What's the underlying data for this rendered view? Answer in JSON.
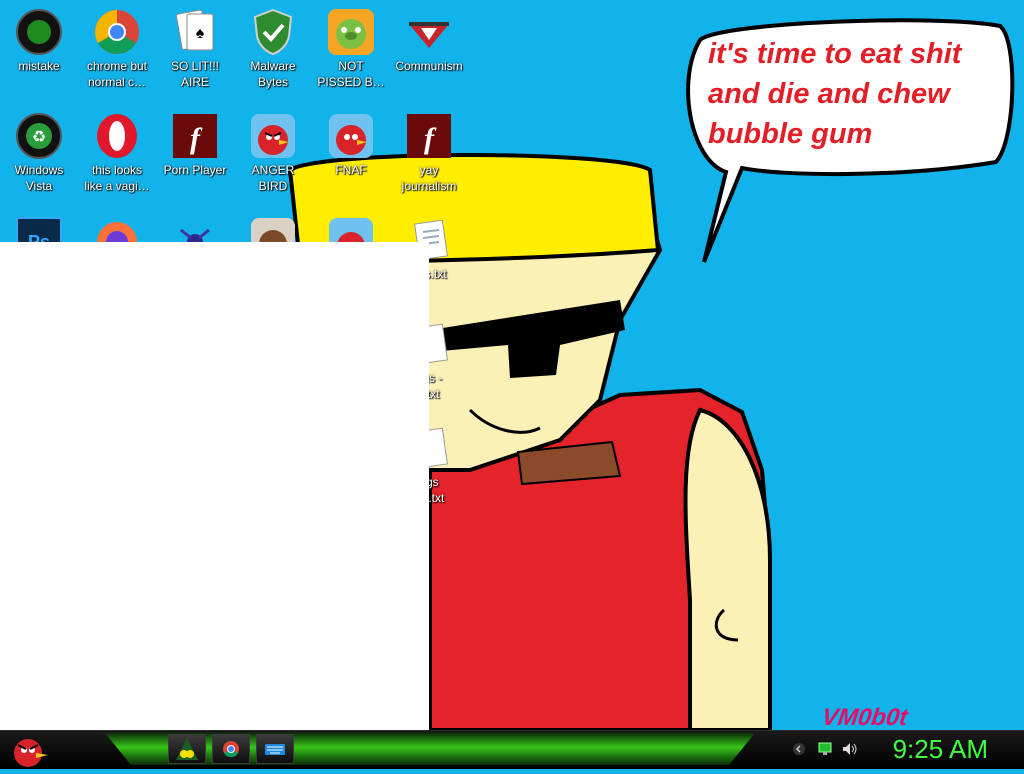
{
  "desktop_icons": {
    "mistake": "mistake",
    "chrome": [
      "chrome but",
      "normal c…"
    ],
    "solitaire": [
      "SO LIT!!!",
      "AIRE"
    ],
    "malwarebytes": [
      "Malware",
      "Bytes"
    ],
    "not_pissed": [
      "NOT",
      "PISSED B…"
    ],
    "communism": "Communism",
    "windows_vista": [
      "Windows",
      "Vista"
    ],
    "opera": [
      "this looks",
      "like a vagi…"
    ],
    "porn_player": "Porn Player",
    "anger_bird": [
      "ANGER",
      "BIRD"
    ],
    "fnaf": "FNAF",
    "yay_journalism": [
      "yay",
      "journalism"
    ],
    "txt1": "ngs.txt",
    "txt2": [
      "ngs -",
      "y.txt"
    ],
    "txt3": [
      "ngs",
      "(2).txt"
    ]
  },
  "wallpaper": {
    "speech_text": [
      "it's time to eat shit",
      "and die and chew",
      "bubble gum"
    ],
    "signature": "VM0b0t"
  },
  "taskbar": {
    "clock": "9:25 AM",
    "pinned": [
      "start-angry-bird",
      "app-group",
      "chrome",
      "keyboard"
    ]
  },
  "colors": {
    "sky": "#12b3ea",
    "hair": "#ffee00",
    "skin": "#fbf0b6",
    "shirt": "#e4232b",
    "speech_text": "#e41e26",
    "clock_green": "#3fff3f",
    "taskbar_green": "#39c61a"
  }
}
